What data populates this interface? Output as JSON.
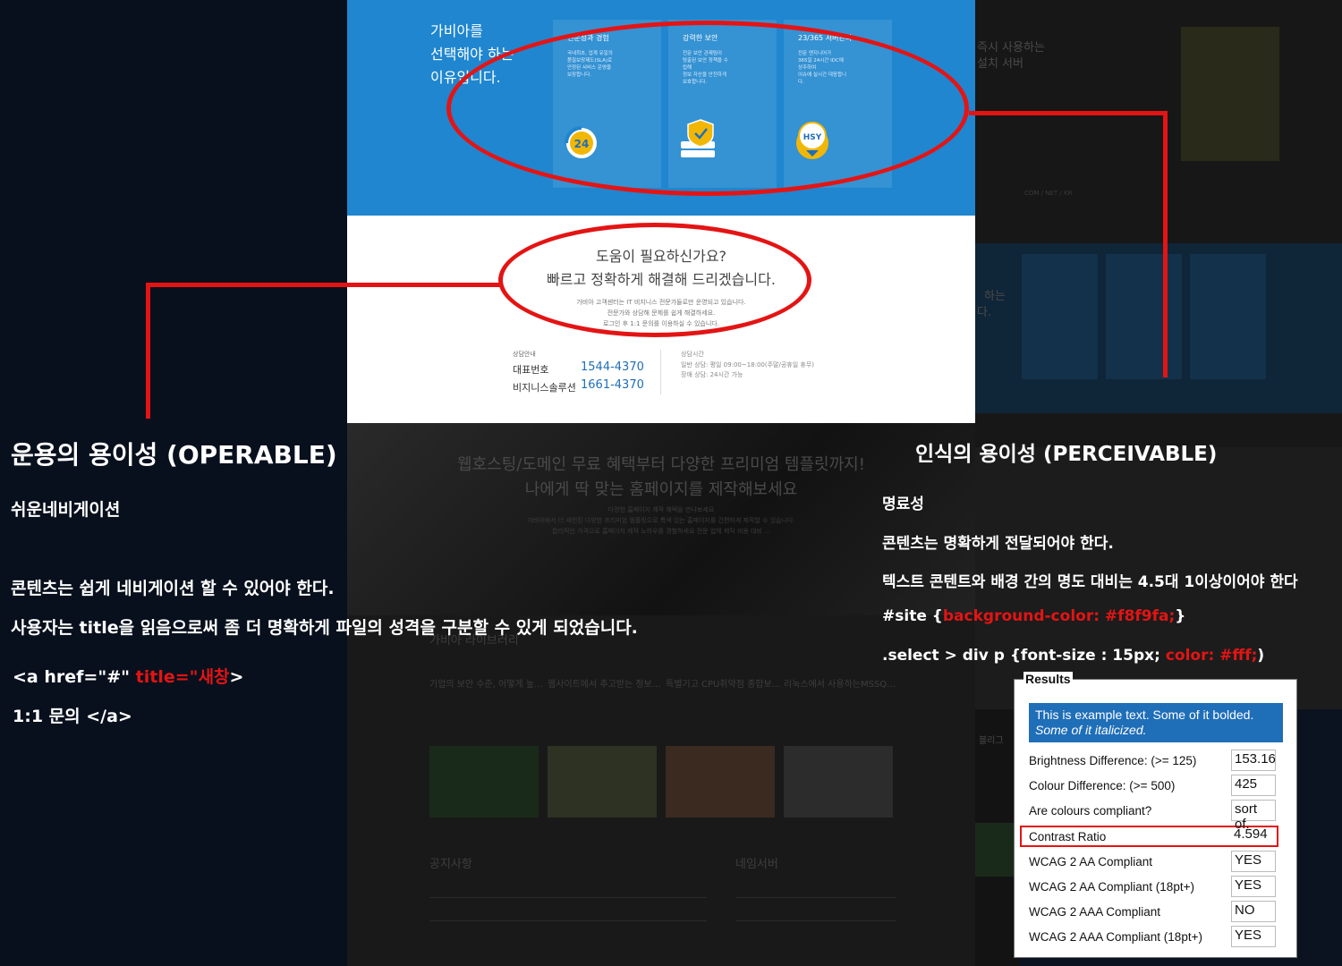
{
  "colors": {
    "accent_red": "#e41414",
    "blue_band": "#1f86cf",
    "phone_blue": "#1f6eb8"
  },
  "screenshot": {
    "why_title": [
      "가비아를",
      "선택해야 하는",
      "이유입니다."
    ],
    "cards": [
      {
        "title": "전문성과 경험",
        "desc": [
          "국내최초, 업계 유일의",
          "품질보장제도(SLA)로",
          "안정된 서비스 운영을",
          "보장합니다."
        ],
        "icon": "24-support-icon"
      },
      {
        "title": "강력한 보안",
        "desc": [
          "전문 보안 관제팀이",
          "탐출된 보안 정책을 수",
          "립해",
          "정보 자산을 안전하게",
          "보호합니다."
        ],
        "icon": "shield-server-icon"
      },
      {
        "title": "23/365 서버관리",
        "desc": [
          "전문 엔지니어가",
          "365일 24시간 IDC에",
          "상주하여",
          "이슈에 실시간 대응합니",
          "다."
        ],
        "icon": "hsy-badge-icon"
      }
    ],
    "help_title_1": "도움이 필요하신가요?",
    "help_title_2": "빠르고 정확하게 해결해 드리겠습니다.",
    "help_desc": [
      "가비아 고객센터는 IT 비지니스 전문가들로만 운영되고 있습니다.",
      "전문가와 상담해 문제를 쉽게 해결하세요.",
      "로그인 후 1:1 문의를 이용하실 수 있습니다."
    ],
    "consult_label": "상담안내",
    "rep_key": "대표번호",
    "rep_val": "1544-4370",
    "biz_key": "비지니스솔루션",
    "biz_val": "1661-4370",
    "hours_label": "상담시간",
    "hours_1": "일반 상담: 평일 09:00~18:00(주말/공휴일 휴무)",
    "hours_2": "장애 상담: 24시간 가능"
  },
  "dim_page": {
    "headline_1": "웹호스팅/도메인 무료 혜택부터 다양한 프리미엄 템플릿까지!",
    "headline_2": "나에게 딱 맞는 홈페이지를 제작해보세요",
    "desc_1": "다양한 홈페이지 제작 혜택을 만나보세요",
    "desc_2": "가비아에서 더 세련된 다양한 프리미엄 템플릿으로 특색 있는 홈페이지를 간편하게 제작할 수 있습니다.",
    "desc_3": "합리적인 가격으로 홈페이지 제작 노하우를 경험하세요 전문 업체 제작 비용 대비 ...",
    "section": "가비아 라이브러리",
    "articles": [
      "기업의 보안 수준, 어떻게 높...",
      "웹사이트에서 추고받는 정보...",
      "특별기고 CPU취약점 종합보...",
      "리눅스에서 사용하는MSSQ..."
    ],
    "notice": "공지사항",
    "nameserver": "네임서버",
    "right_1": "즉시 사용하는",
    "right_2": "설치 서버",
    "right_3": "COM / NET / KR",
    "right_4": "하는",
    "right_5": "다.",
    "right_6": "블리그"
  },
  "operable": {
    "title": "운용의 용이성 (OPERABLE)",
    "subtitle": "쉬운네비게이션",
    "line1": "콘텐츠는 쉽게 네비게이션 할 수 있어야 한다.",
    "line2": "사용자는 title을 읽음으로써 좀 더 명확하게 파일의 성격을 구분할 수 있게 되었습니다.",
    "code_a": "<a href=\"#\" ",
    "code_title": "title=\"새창",
    "code_close": ">",
    "code_line2": "1:1 문의 </a>"
  },
  "perceivable": {
    "title": "인식의 용이성 (PERCEIVABLE)",
    "subtitle": "명료성",
    "line1": "콘텐츠는 명확하게 전달되어야 한다.",
    "line2": "텍스트 콘텐트와 배경 간의 명도 대비는 4.5대 1이상이어야 한다",
    "css1_sel": "#site {",
    "css1_red": "background-color: #f8f9fa;",
    "css1_end": "}",
    "css2_sel": ".select > div p {font-size : 15px; ",
    "css2_red": "color: #fff;",
    "css2_end": ")"
  },
  "results": {
    "legend": "Results",
    "sample_bold": "This is example text. Some of it bolded.",
    "sample_italic": "Some of it italicized.",
    "rows": [
      {
        "label": "Brightness Difference: (>= 125)",
        "value": "153.16"
      },
      {
        "label": "Colour Difference: (>= 500)",
        "value": "425"
      },
      {
        "label": "Are colours compliant?",
        "value": "sort of."
      },
      {
        "label": "Contrast Ratio",
        "value": "4.594"
      },
      {
        "label": "WCAG 2 AA Compliant",
        "value": "YES"
      },
      {
        "label": "WCAG 2 AA Compliant (18pt+)",
        "value": "YES"
      },
      {
        "label": "WCAG 2 AAA Compliant",
        "value": "NO"
      },
      {
        "label": "WCAG 2 AAA Compliant (18pt+)",
        "value": "YES"
      }
    ]
  }
}
